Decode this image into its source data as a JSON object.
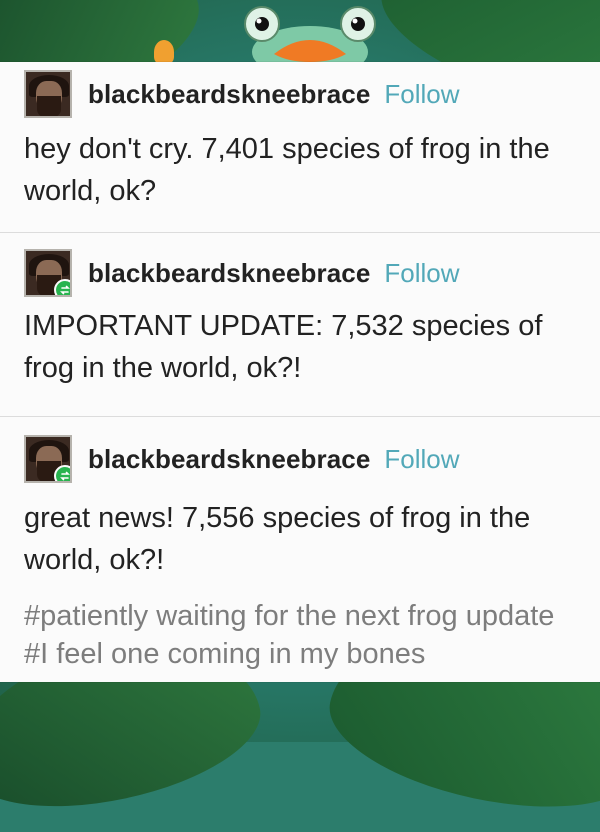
{
  "posts": [
    {
      "username": "blackbeardskneebrace",
      "follow": "Follow",
      "text": "hey don't cry. 7,401 species of frog in the world, ok?"
    },
    {
      "username": "blackbeardskneebrace",
      "follow": "Follow",
      "text": "IMPORTANT UPDATE: 7,532 species of frog in the world, ok?!"
    },
    {
      "username": "blackbeardskneebrace",
      "follow": "Follow",
      "text": "great news! 7,556 species of frog in the world, ok?!",
      "tags": "#patiently waiting for the next frog update  #I feel one coming in my bones"
    }
  ],
  "colors": {
    "follow": "#52a8b8",
    "reblog_badge": "#28b44f",
    "leaf": "#2a6a3a"
  },
  "icons": [
    "frog-peeking",
    "reblog-icon"
  ]
}
